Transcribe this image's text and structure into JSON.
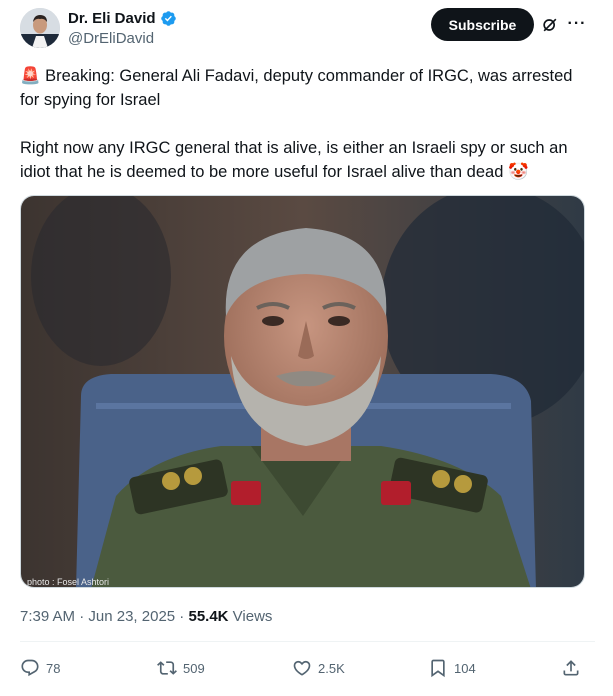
{
  "author": {
    "name": "Dr. Eli David",
    "handle": "@DrEliDavid",
    "verified": true
  },
  "header": {
    "subscribe_label": "Subscribe",
    "more_label": "···",
    "grok_icon": "grok-icon"
  },
  "tweet": {
    "line1": "🚨 Breaking: General Ali Fadavi, deputy commander of IRGC, was arrested for spying for Israel",
    "line2": "Right now any IRGC general that is alive, is either an Israeli spy or such an idiot that he is deemed to be more useful for Israel alive than dead 🤡"
  },
  "media": {
    "watermark": "photo : Fosel Ashtori"
  },
  "meta": {
    "time": "7:39 AM",
    "separator": " · ",
    "date": "Jun 23, 2025",
    "views_count": "55.4K",
    "views_label": " Views"
  },
  "actions": {
    "replies": "78",
    "reposts": "509",
    "likes": "2.5K",
    "bookmarks": "104"
  },
  "colors": {
    "accent": "#1d9bf0",
    "text": "#0f1419",
    "muted": "#536471"
  }
}
